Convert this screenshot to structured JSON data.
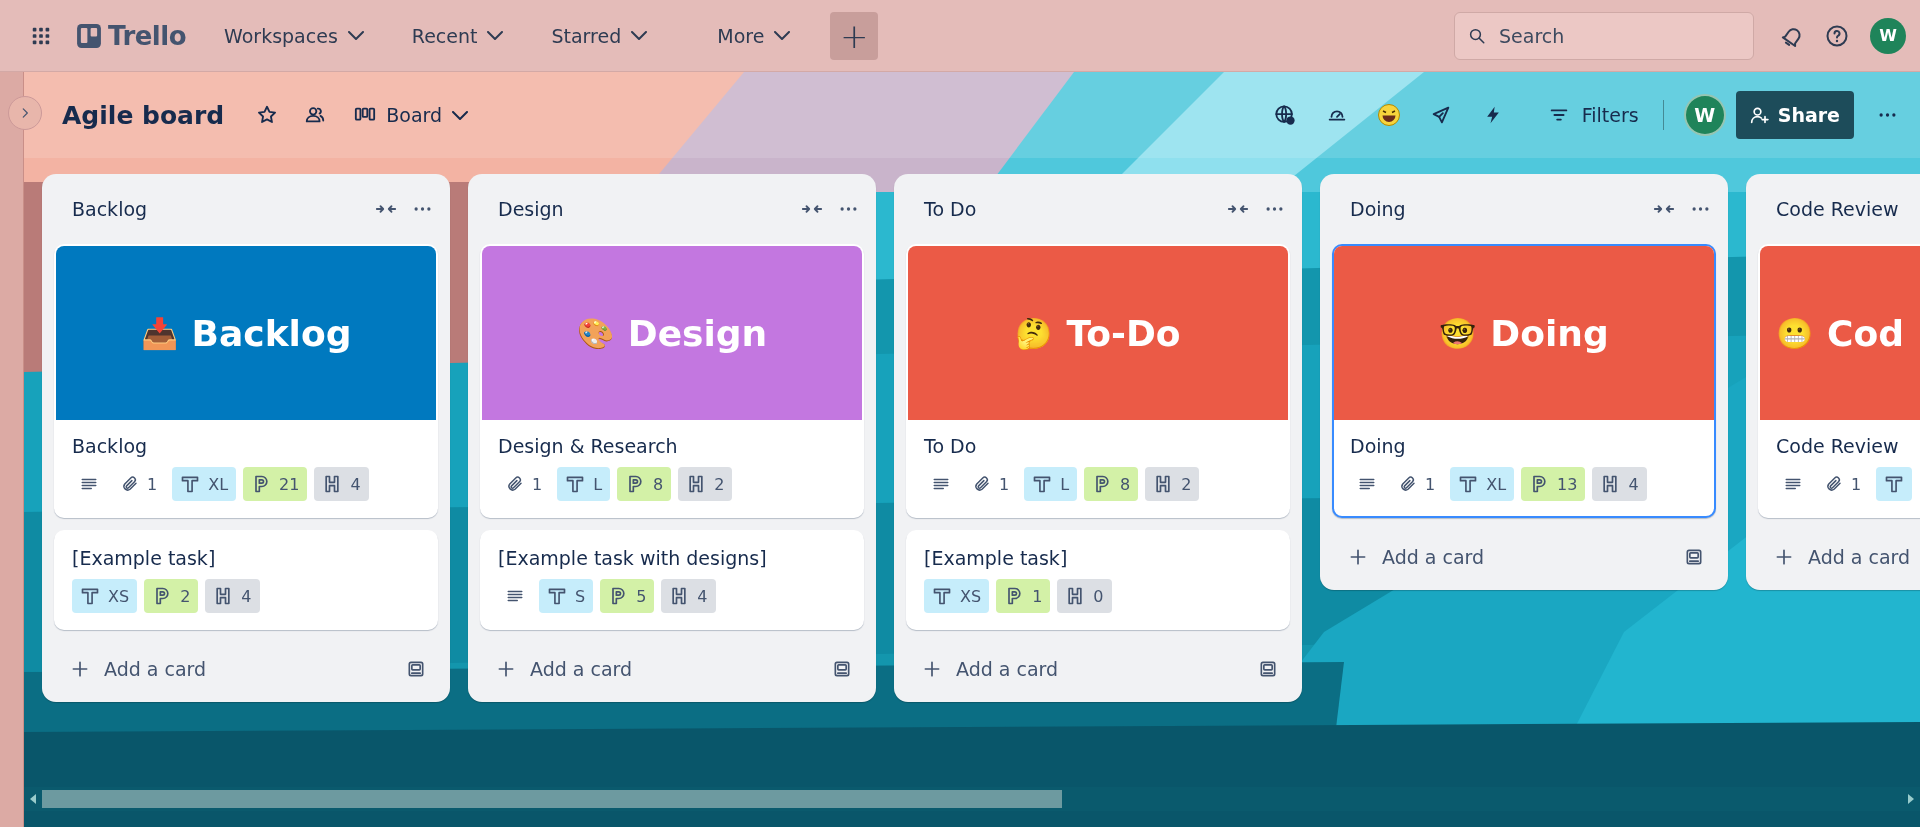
{
  "top_bar": {
    "logo": "Trello",
    "nav": [
      {
        "label": "Workspaces"
      },
      {
        "label": "Recent"
      },
      {
        "label": "Starred"
      },
      {
        "label": "More"
      }
    ],
    "create_label": "+",
    "search": {
      "placeholder": "Search"
    },
    "avatar": "W"
  },
  "board_header": {
    "title": "Agile board",
    "view": "Board",
    "filters": "Filters",
    "member": "W",
    "share": "Share"
  },
  "lists": [
    {
      "title": "Backlog",
      "cards": [
        {
          "cover": {
            "color": "#0079bf",
            "emoji": "📥",
            "title": "Backlog"
          },
          "title": "Backlog",
          "selected": false,
          "badges": [
            {
              "kind": "description"
            },
            {
              "kind": "attachment",
              "text": "1"
            },
            {
              "kind": "size",
              "text": "XL"
            },
            {
              "kind": "points",
              "text": "21"
            },
            {
              "kind": "hours",
              "text": "4"
            }
          ]
        },
        {
          "title": "[Example task]",
          "selected": false,
          "badges": [
            {
              "kind": "size",
              "text": "XS"
            },
            {
              "kind": "points",
              "text": "2"
            },
            {
              "kind": "hours",
              "text": "4"
            }
          ]
        }
      ],
      "add_label": "Add a card"
    },
    {
      "title": "Design",
      "cards": [
        {
          "cover": {
            "color": "#c377e0",
            "emoji": "🎨",
            "title": "Design"
          },
          "title": "Design & Research",
          "selected": false,
          "badges": [
            {
              "kind": "attachment",
              "text": "1"
            },
            {
              "kind": "size",
              "text": "L"
            },
            {
              "kind": "points",
              "text": "8"
            },
            {
              "kind": "hours",
              "text": "2"
            }
          ]
        },
        {
          "title": "[Example task with designs]",
          "selected": false,
          "badges": [
            {
              "kind": "description"
            },
            {
              "kind": "size",
              "text": "S"
            },
            {
              "kind": "points",
              "text": "5"
            },
            {
              "kind": "hours",
              "text": "4"
            }
          ]
        }
      ],
      "add_label": "Add a card"
    },
    {
      "title": "To Do",
      "cards": [
        {
          "cover": {
            "color": "#eb5a46",
            "emoji": "🤔",
            "title": "To-Do"
          },
          "title": "To Do",
          "selected": false,
          "badges": [
            {
              "kind": "description"
            },
            {
              "kind": "attachment",
              "text": "1"
            },
            {
              "kind": "size",
              "text": "L"
            },
            {
              "kind": "points",
              "text": "8"
            },
            {
              "kind": "hours",
              "text": "2"
            }
          ]
        },
        {
          "title": "[Example task]",
          "selected": false,
          "badges": [
            {
              "kind": "size",
              "text": "XS"
            },
            {
              "kind": "points",
              "text": "1"
            },
            {
              "kind": "hours",
              "text": "0"
            }
          ]
        }
      ],
      "add_label": "Add a card"
    },
    {
      "title": "Doing",
      "cards": [
        {
          "cover": {
            "color": "#eb5a46",
            "emoji": "🤓",
            "title": "Doing"
          },
          "title": "Doing",
          "selected": true,
          "badges": [
            {
              "kind": "description"
            },
            {
              "kind": "attachment",
              "text": "1"
            },
            {
              "kind": "size",
              "text": "XL"
            },
            {
              "kind": "points",
              "text": "13"
            },
            {
              "kind": "hours",
              "text": "4"
            }
          ]
        }
      ],
      "add_label": "Add a card"
    },
    {
      "title": "Code Review",
      "cards": [
        {
          "cover": {
            "color": "#eb5a46",
            "emoji": "😬",
            "title": "Cod"
          },
          "title": "Code Review",
          "selected": false,
          "badges": [
            {
              "kind": "description"
            },
            {
              "kind": "attachment",
              "text": "1"
            },
            {
              "kind": "size"
            }
          ]
        }
      ],
      "add_label": "Add a card"
    }
  ]
}
